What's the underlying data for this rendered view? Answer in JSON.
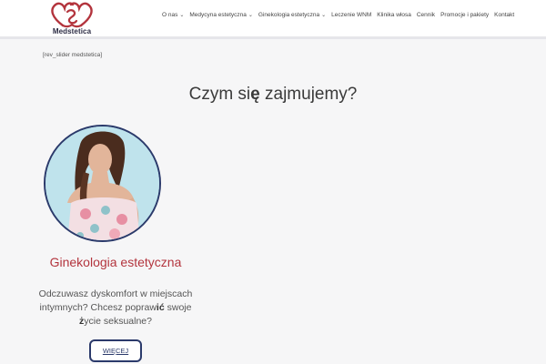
{
  "brand": {
    "name": "Medstetica",
    "color": "#b3343d",
    "navy": "#2b3a6b"
  },
  "nav": [
    {
      "label": "O nas",
      "dropdown": true
    },
    {
      "label": "Medycyna estetyczna",
      "dropdown": true
    },
    {
      "label": "Ginekologia estetyczna",
      "dropdown": true
    },
    {
      "label": "Leczenie WNM",
      "dropdown": false
    },
    {
      "label": "Klinika włosa",
      "dropdown": false
    },
    {
      "label": "Cennik",
      "dropdown": false
    },
    {
      "label": "Promocje i pakiety",
      "dropdown": false
    },
    {
      "label": "Kontakt",
      "dropdown": false
    }
  ],
  "shortcode": "[rev_slider medstetica]",
  "section": {
    "title_pre": "Czym si",
    "title_bold": "ę",
    "title_post": " zajmujemy?"
  },
  "card": {
    "title": "Ginekologia estetyczna",
    "text_1": "Odczuwasz dyskomfort w miejscach intymnych? Chcesz popraw",
    "text_2": "ić",
    "text_3": " swoje ",
    "text_4": "ż",
    "text_5": "ycie seksualne?",
    "button": "WIĘCEJ"
  }
}
